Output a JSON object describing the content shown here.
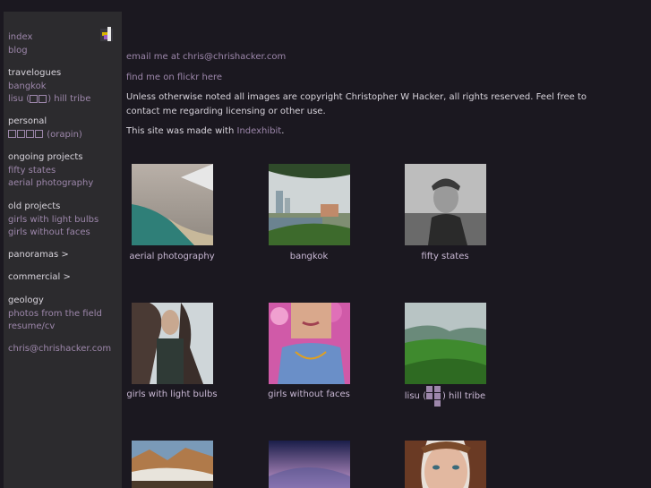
{
  "sidebar": {
    "links_top": [
      "index",
      "blog"
    ],
    "travelogues_heading": "travelogues",
    "travelogues": [
      "bangkok",
      "lisu (",
      ") hill tribe"
    ],
    "personal_heading": "personal",
    "personal_item": "(orapin)",
    "ongoing_heading": "ongoing projects",
    "ongoing": [
      "fifty states",
      "aerial photography"
    ],
    "old_heading": "old projects",
    "old": [
      "girls with light bulbs",
      "girls without faces"
    ],
    "panoramas": "panoramas >",
    "commercial": "commercial >",
    "geology_heading": "geology",
    "geology": [
      "photos from the field",
      "resume/cv"
    ],
    "email": "chris@chrishacker.com"
  },
  "main": {
    "email_line": "email me at chris@chrishacker.com",
    "flickr_line": "find me on flickr here",
    "copyright": "Unless otherwise noted all images are copyright Christopher W Hacker, all rights reserved. Feel free to contact me regarding licensing or other use.",
    "made_prefix": "This site was made with ",
    "made_link": "Indexhibit",
    "made_suffix": "."
  },
  "gallery": [
    {
      "caption": "aerial photography"
    },
    {
      "caption": "bangkok"
    },
    {
      "caption": "fifty states"
    },
    {
      "caption": "girls with light bulbs"
    },
    {
      "caption": "girls without faces"
    },
    {
      "caption_prefix": "lisu (",
      "caption_suffix": ") hill tribe"
    }
  ],
  "colors": {
    "background": "#1b1820",
    "sidebar": "#2c2b2e",
    "link": "#9d87ab",
    "text": "#d8d4dc"
  }
}
